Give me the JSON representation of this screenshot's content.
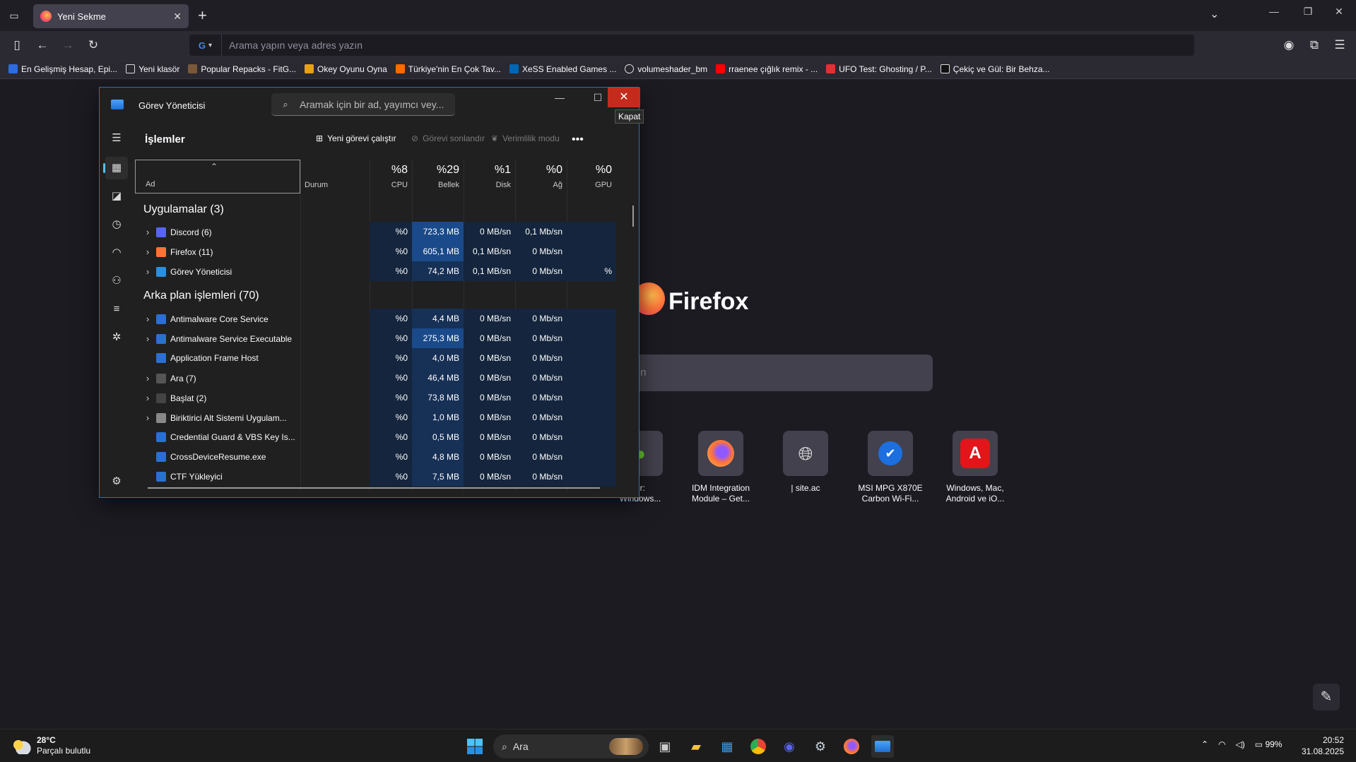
{
  "browser": {
    "tab_title": "Yeni Sekme",
    "url_placeholder": "Arama yapın veya adres yazın",
    "url_engine": "G",
    "bookmarks": [
      "En Gelişmiş Hesap, Epi...",
      "Yeni klasör",
      "Popular Repacks - FitG...",
      "Okey Oyunu Oyna",
      "Türkiye'nin En Çok Tav...",
      "XeSS Enabled Games ...",
      "volumeshader_bm",
      "rraenee çığlık remix - ...",
      "UFO Test: Ghosting / P...",
      "Çekiç ve Gül: Bir Behza..."
    ]
  },
  "newtab": {
    "brand": "Firefox",
    "search_partial": "ın",
    "shortcuts": [
      "er:\nWindows...",
      "IDM Integration\nModule – Get...",
      "| site.ac",
      "MSI MPG X870E\nCarbon Wi-Fi...",
      "Windows, Mac,\nAndroid ve iO..."
    ]
  },
  "taskmanager": {
    "title": "Görev Yöneticisi",
    "search_placeholder": "Aramak için bir ad, yayımcı vey...",
    "close_tooltip": "Kapat",
    "section": "İşlemler",
    "toolbar": {
      "run_task": "Yeni görevi çalıştır",
      "end_task": "Görevi sonlandır",
      "efficiency": "Verimlilik modu"
    },
    "columns": {
      "name": "Ad",
      "status": "Durum",
      "cpu_pct": "%8",
      "cpu": "CPU",
      "mem_pct": "%29",
      "mem": "Bellek",
      "disk_pct": "%1",
      "disk": "Disk",
      "net_pct": "%0",
      "net": "Ağ",
      "gpu_pct": "%0",
      "gpu": "GPU"
    },
    "group_apps": "Uygulamalar (3)",
    "group_bg": "Arka plan işlemleri (70)",
    "apps": [
      {
        "name": "Discord (6)",
        "cpu": "%0",
        "mem": "723,3 MB",
        "disk": "0 MB/sn",
        "net": "0,1 Mb/sn",
        "gpu": ""
      },
      {
        "name": "Firefox (11)",
        "cpu": "%0",
        "mem": "605,1 MB",
        "disk": "0,1 MB/sn",
        "net": "0 Mb/sn",
        "gpu": ""
      },
      {
        "name": "Görev Yöneticisi",
        "cpu": "%0",
        "mem": "74,2 MB",
        "disk": "0,1 MB/sn",
        "net": "0 Mb/sn",
        "gpu": "%"
      }
    ],
    "background": [
      {
        "name": "Antimalware Core Service",
        "cpu": "%0",
        "mem": "4,4 MB",
        "disk": "0 MB/sn",
        "net": "0 Mb/sn"
      },
      {
        "name": "Antimalware Service Executable",
        "cpu": "%0",
        "mem": "275,3 MB",
        "disk": "0 MB/sn",
        "net": "0 Mb/sn"
      },
      {
        "name": "Application Frame Host",
        "cpu": "%0",
        "mem": "4,0 MB",
        "disk": "0 MB/sn",
        "net": "0 Mb/sn"
      },
      {
        "name": "Ara (7)",
        "cpu": "%0",
        "mem": "46,4 MB",
        "disk": "0 MB/sn",
        "net": "0 Mb/sn"
      },
      {
        "name": "Başlat (2)",
        "cpu": "%0",
        "mem": "73,8 MB",
        "disk": "0 MB/sn",
        "net": "0 Mb/sn"
      },
      {
        "name": "Biriktirici Alt Sistemi Uygulam...",
        "cpu": "%0",
        "mem": "1,0 MB",
        "disk": "0 MB/sn",
        "net": "0 Mb/sn"
      },
      {
        "name": "Credential Guard & VBS Key Is...",
        "cpu": "%0",
        "mem": "0,5 MB",
        "disk": "0 MB/sn",
        "net": "0 Mb/sn"
      },
      {
        "name": "CrossDeviceResume.exe",
        "cpu": "%0",
        "mem": "4,8 MB",
        "disk": "0 MB/sn",
        "net": "0 Mb/sn"
      },
      {
        "name": "CTF Yükleyici",
        "cpu": "%0",
        "mem": "7,5 MB",
        "disk": "0 MB/sn",
        "net": "0 Mb/sn"
      }
    ]
  },
  "taskbar": {
    "weather_temp": "28°C",
    "weather_desc": "Parçalı bulutlu",
    "search_label": "Ara",
    "battery": "99%",
    "time": "20:52",
    "date": "31.08.2025"
  },
  "colors": {
    "accent": "#4cc2ff",
    "close_red": "#c42b1c",
    "mem_highlight": "#1a4a8a",
    "cell_tint": "#14253d"
  }
}
